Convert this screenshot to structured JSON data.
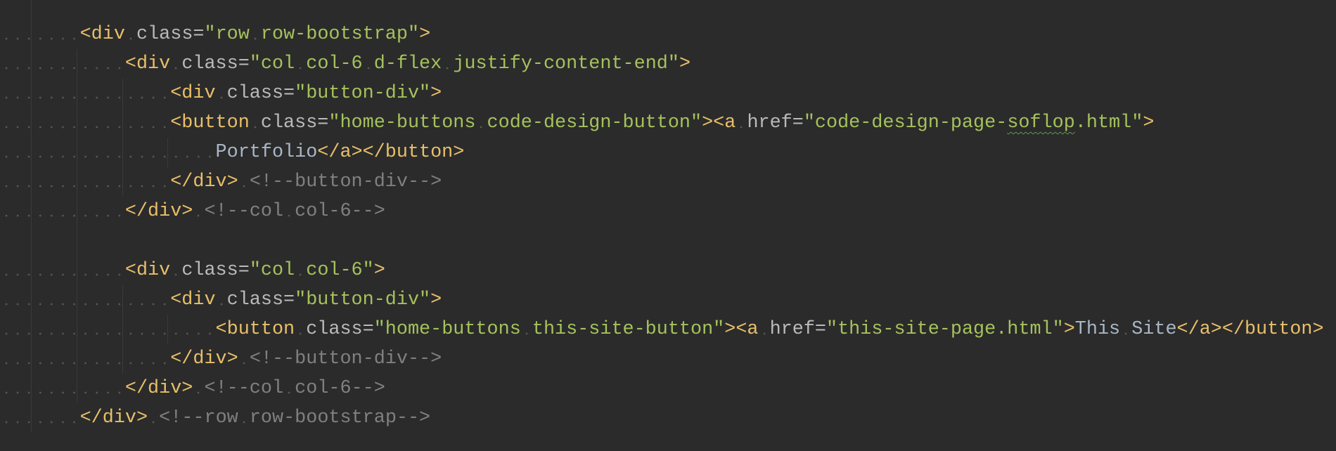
{
  "editor": {
    "colors": {
      "background": "#2b2b2b",
      "tag": "#e8bf6a",
      "attr": "#bababa",
      "value": "#a5c25c",
      "text": "#a9b7c6",
      "comment": "#808080"
    },
    "lines": [
      [
        [
          "ws",
          "       "
        ],
        [
          "tag",
          "<div"
        ],
        [
          "ws",
          " "
        ],
        [
          "attr",
          "class="
        ],
        [
          "val",
          "\"row"
        ],
        [
          "ws",
          " "
        ],
        [
          "val",
          "row-bootstrap\""
        ],
        [
          "tag",
          ">"
        ]
      ],
      [
        [
          "ws",
          "           "
        ],
        [
          "tag",
          "<div"
        ],
        [
          "ws",
          " "
        ],
        [
          "attr",
          "class="
        ],
        [
          "val",
          "\"col"
        ],
        [
          "ws",
          " "
        ],
        [
          "val",
          "col-6"
        ],
        [
          "ws",
          " "
        ],
        [
          "val",
          "d-flex"
        ],
        [
          "ws",
          " "
        ],
        [
          "val",
          "justify-content-end\""
        ],
        [
          "tag",
          ">"
        ]
      ],
      [
        [
          "ws",
          "               "
        ],
        [
          "tag",
          "<div"
        ],
        [
          "ws",
          " "
        ],
        [
          "attr",
          "class="
        ],
        [
          "val",
          "\"button-div\""
        ],
        [
          "tag",
          ">"
        ]
      ],
      [
        [
          "ws",
          "               "
        ],
        [
          "tag",
          "<button"
        ],
        [
          "ws",
          " "
        ],
        [
          "attr",
          "class="
        ],
        [
          "val",
          "\"home-buttons"
        ],
        [
          "ws",
          " "
        ],
        [
          "val",
          "code-design-button\""
        ],
        [
          "tag",
          "><a"
        ],
        [
          "ws",
          " "
        ],
        [
          "attr",
          "href="
        ],
        [
          "val",
          "\"code-design-page-"
        ],
        [
          "squiggle",
          "soflop"
        ],
        [
          "val",
          ".html\""
        ],
        [
          "tag",
          ">"
        ]
      ],
      [
        [
          "ws",
          "                   "
        ],
        [
          "text",
          "Portfolio"
        ],
        [
          "tag",
          "</a></button>"
        ]
      ],
      [
        [
          "ws",
          "               "
        ],
        [
          "tag",
          "</div>"
        ],
        [
          "ws",
          " "
        ],
        [
          "comment",
          "<!--button-div-->"
        ]
      ],
      [
        [
          "ws",
          "           "
        ],
        [
          "tag",
          "</div>"
        ],
        [
          "ws",
          " "
        ],
        [
          "comment",
          "<!--col"
        ],
        [
          "ws",
          " "
        ],
        [
          "comment",
          "col-6-->"
        ]
      ],
      [],
      [
        [
          "ws",
          "           "
        ],
        [
          "tag",
          "<div"
        ],
        [
          "ws",
          " "
        ],
        [
          "attr",
          "class="
        ],
        [
          "val",
          "\"col"
        ],
        [
          "ws",
          " "
        ],
        [
          "val",
          "col-6\""
        ],
        [
          "tag",
          ">"
        ]
      ],
      [
        [
          "ws",
          "               "
        ],
        [
          "tag",
          "<div"
        ],
        [
          "ws",
          " "
        ],
        [
          "attr",
          "class="
        ],
        [
          "val",
          "\"button-div\""
        ],
        [
          "tag",
          ">"
        ]
      ],
      [
        [
          "ws",
          "                   "
        ],
        [
          "tag",
          "<button"
        ],
        [
          "ws",
          " "
        ],
        [
          "attr",
          "class="
        ],
        [
          "val",
          "\"home-buttons"
        ],
        [
          "ws",
          " "
        ],
        [
          "val",
          "this-site-button\""
        ],
        [
          "tag",
          "><a"
        ],
        [
          "ws",
          " "
        ],
        [
          "attr",
          "href="
        ],
        [
          "val",
          "\"this-site-page.html\""
        ],
        [
          "tag",
          ">"
        ],
        [
          "text",
          "This"
        ],
        [
          "ws",
          " "
        ],
        [
          "text",
          "Site"
        ],
        [
          "tag",
          "</a></button>"
        ]
      ],
      [
        [
          "ws",
          "               "
        ],
        [
          "tag",
          "</div>"
        ],
        [
          "ws",
          " "
        ],
        [
          "comment",
          "<!--button-div-->"
        ]
      ],
      [
        [
          "ws",
          "           "
        ],
        [
          "tag",
          "</div>"
        ],
        [
          "ws",
          " "
        ],
        [
          "comment",
          "<!--col"
        ],
        [
          "ws",
          " "
        ],
        [
          "comment",
          "col-6-->"
        ]
      ],
      [
        [
          "ws",
          "       "
        ],
        [
          "tag",
          "</div>"
        ],
        [
          "ws",
          " "
        ],
        [
          "comment",
          "<!--row"
        ],
        [
          "ws",
          " "
        ],
        [
          "comment",
          "row-bootstrap-->"
        ]
      ]
    ]
  }
}
